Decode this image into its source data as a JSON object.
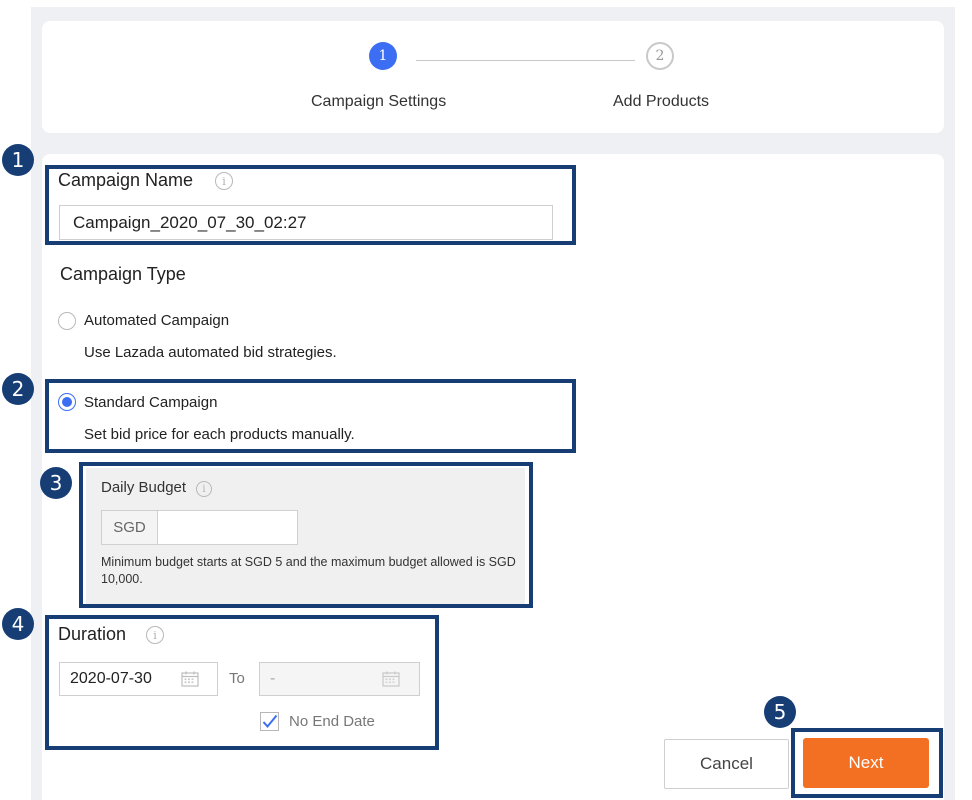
{
  "steps": [
    {
      "number": "1",
      "label": "Campaign Settings"
    },
    {
      "number": "2",
      "label": "Add Products"
    }
  ],
  "annotations": [
    "1",
    "2",
    "3",
    "4",
    "5"
  ],
  "campaign_name": {
    "label": "Campaign Name",
    "info_icon": "i",
    "value": "Campaign_2020_07_30_02:27"
  },
  "campaign_type": {
    "label": "Campaign Type",
    "options": [
      {
        "label": "Automated Campaign",
        "description": "Use Lazada automated bid strategies.",
        "selected": false
      },
      {
        "label": "Standard Campaign",
        "description": "Set bid price for each products manually.",
        "selected": true
      }
    ]
  },
  "daily_budget": {
    "label": "Daily Budget",
    "info_icon": "i",
    "currency": "SGD",
    "value": "",
    "hint": "Minimum budget starts at SGD 5 and the maximum budget allowed is SGD 10,000."
  },
  "duration": {
    "label": "Duration",
    "info_icon": "i",
    "start_date": "2020-07-30",
    "to_label": "To",
    "end_date": "-",
    "no_end_date_label": "No End Date",
    "no_end_date_checked": true
  },
  "buttons": {
    "cancel": "Cancel",
    "next": "Next"
  },
  "colors": {
    "accent_blue": "#3b6ef3",
    "annotation_navy": "#163e75",
    "next_orange": "#f36f21"
  },
  "icons": [
    "info-icon",
    "calendar-icon",
    "check-icon"
  ]
}
